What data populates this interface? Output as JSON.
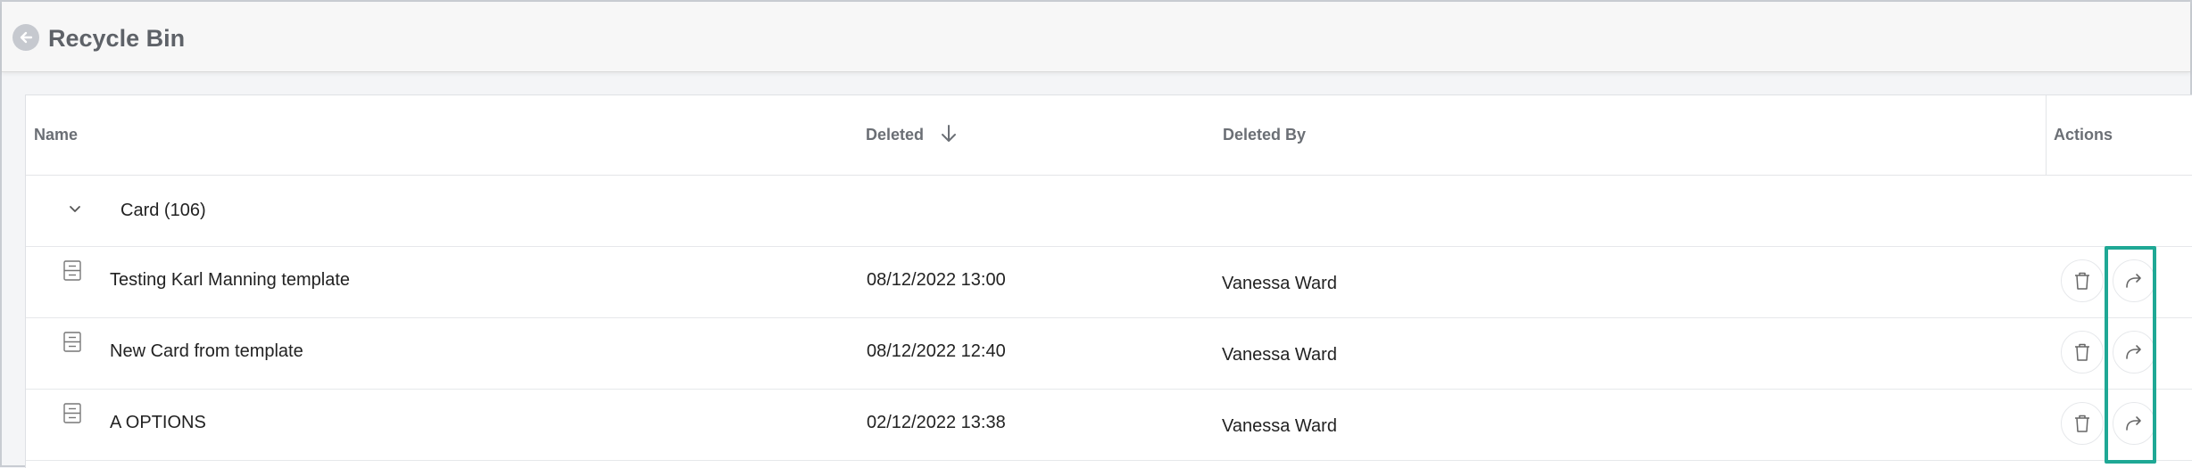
{
  "header": {
    "title": "Recycle Bin",
    "back_icon": "arrow-left-icon"
  },
  "table": {
    "columns": {
      "name": "Name",
      "deleted": "Deleted",
      "deleted_by": "Deleted By",
      "actions": "Actions"
    },
    "sort": {
      "column": "deleted",
      "direction": "descending",
      "icon": "arrow-down-icon"
    },
    "group": {
      "label": "Card",
      "count": "(106)",
      "expanded": true,
      "icon": "chevron-down-icon"
    },
    "rows": [
      {
        "name": "Testing Karl Manning template",
        "deleted": "08/12/2022 13:00",
        "deleted_by": "Vanessa Ward"
      },
      {
        "name": "New Card from template",
        "deleted": "08/12/2022 12:40",
        "deleted_by": "Vanessa Ward"
      },
      {
        "name": "A OPTIONS",
        "deleted": "02/12/2022 13:38",
        "deleted_by": "Vanessa Ward"
      }
    ],
    "row_icons": {
      "type": "card-icon",
      "delete": "trash-icon",
      "restore": "restore-arrow-icon"
    }
  },
  "colors": {
    "highlight": "#1fa895",
    "title_text": "#5e6268",
    "header_text": "#6b6f75",
    "back_button": "#c6c9cf"
  }
}
